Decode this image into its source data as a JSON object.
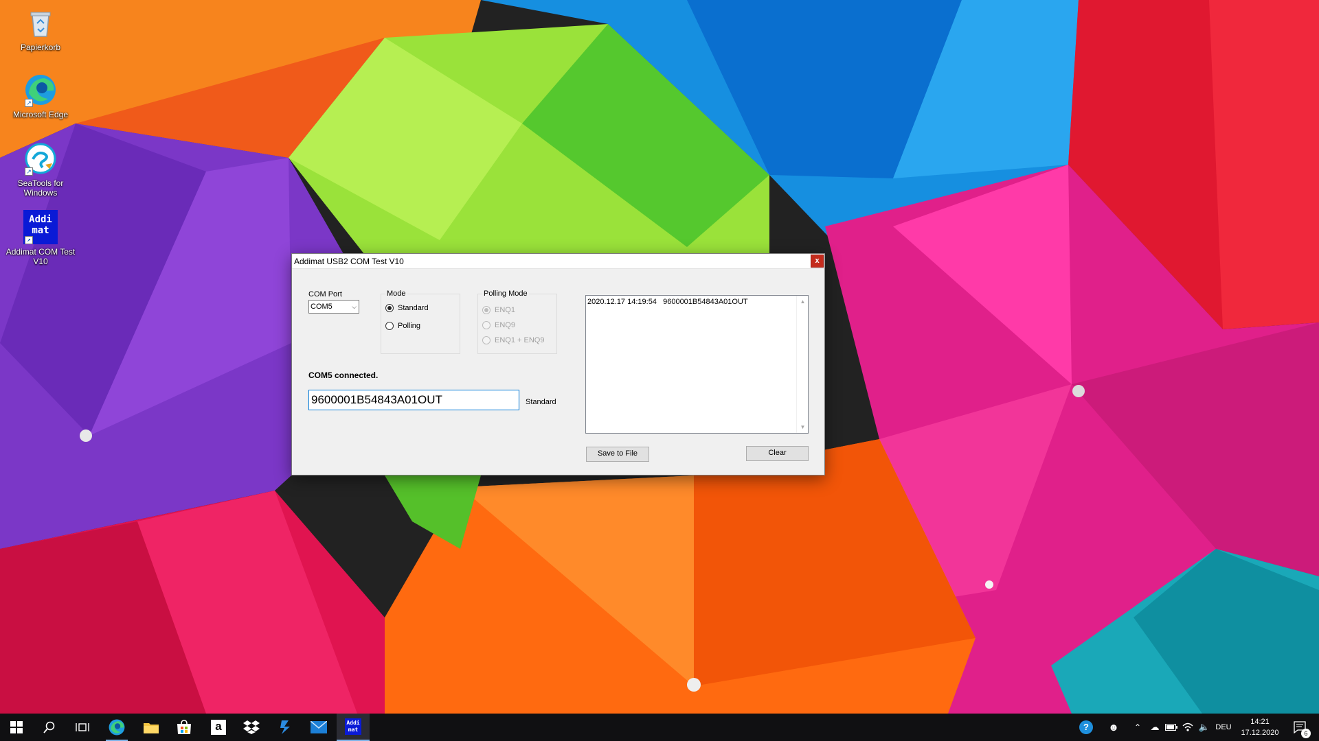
{
  "desktop": {
    "icons": [
      {
        "label": "Papierkorb",
        "icon": "recycle-bin-icon"
      },
      {
        "label": "Microsoft Edge",
        "icon": "edge-icon"
      },
      {
        "label": "SeaTools for Windows",
        "icon": "seatools-icon"
      },
      {
        "label": "Addimat COM Test V10",
        "icon": "addimat-icon",
        "logo_text": "Addi mat"
      }
    ]
  },
  "dialog": {
    "title": "Addimat USB2 COM Test V10",
    "close_label": "x",
    "com_port": {
      "label": "COM Port",
      "value": "COM5"
    },
    "mode": {
      "label": "Mode",
      "options": [
        {
          "label": "Standard",
          "checked": true
        },
        {
          "label": "Polling",
          "checked": false
        }
      ]
    },
    "polling_mode": {
      "label": "Polling Mode",
      "options": [
        {
          "label": "ENQ1",
          "checked": true,
          "disabled": true
        },
        {
          "label": "ENQ9",
          "checked": false,
          "disabled": true
        },
        {
          "label": "ENQ1 + ENQ9",
          "checked": false,
          "disabled": true
        }
      ]
    },
    "status": "COM5 connected.",
    "input_value": "9600001B54843A01OUT",
    "input_mode_label": "Standard",
    "log": [
      "2020.12.17 14:19:54   9600001B54843A01OUT"
    ],
    "save_label": "Save to File",
    "clear_label": "Clear"
  },
  "taskbar": {
    "language": "DEU",
    "time": "14:21",
    "date": "17.12.2020",
    "notification_count": "6",
    "addimat_logo_text": "Addi mat"
  },
  "colors": {
    "accent": "#0078d7",
    "close": "#c42b1c",
    "taskbar": "#101012"
  }
}
